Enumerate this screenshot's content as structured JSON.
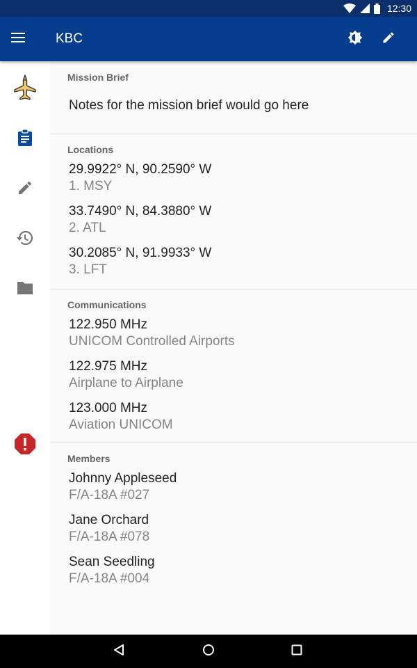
{
  "status_bar": {
    "time": "12:30",
    "icons": [
      "wifi-icon",
      "signal-icon",
      "battery-icon"
    ]
  },
  "app_bar": {
    "title": "KBC",
    "actions": [
      "brightness-icon",
      "edit-icon"
    ],
    "background": "#063d8c"
  },
  "rail": {
    "items": [
      {
        "icon": "jet-icon",
        "active": false
      },
      {
        "icon": "clipboard-icon",
        "active": true
      },
      {
        "icon": "pencil-icon",
        "active": false
      },
      {
        "icon": "history-icon",
        "active": false
      },
      {
        "icon": "folder-icon",
        "active": false
      },
      {
        "icon": "alert-icon",
        "active": false
      }
    ],
    "active_color": "#0b4aa2",
    "alert_color": "#c62828"
  },
  "mission_brief": {
    "title": "Mission Brief",
    "text": "Notes for the mission brief would go here"
  },
  "locations": {
    "title": "Locations",
    "items": [
      {
        "coords": "29.9922° N, 90.2590° W",
        "name": "1. MSY"
      },
      {
        "coords": "33.7490° N, 84.3880° W",
        "name": "2. ATL"
      },
      {
        "coords": "30.2085° N, 91.9933° W",
        "name": "3. LFT"
      }
    ]
  },
  "communications": {
    "title": "Communications",
    "items": [
      {
        "freq": "122.950 MHz",
        "desc": "UNICOM Controlled Airports"
      },
      {
        "freq": "122.975 MHz",
        "desc": "Airplane to Airplane"
      },
      {
        "freq": "123.000 MHz",
        "desc": "Aviation UNICOM"
      }
    ]
  },
  "members": {
    "title": "Members",
    "items": [
      {
        "name": "Johnny Appleseed",
        "aircraft": "F/A-18A #027"
      },
      {
        "name": "Jane Orchard",
        "aircraft": "F/A-18A #078"
      },
      {
        "name": "Sean Seedling",
        "aircraft": "F/A-18A #004"
      }
    ]
  },
  "nav_bar": {
    "buttons": [
      "back-icon",
      "home-icon",
      "recents-icon"
    ]
  }
}
